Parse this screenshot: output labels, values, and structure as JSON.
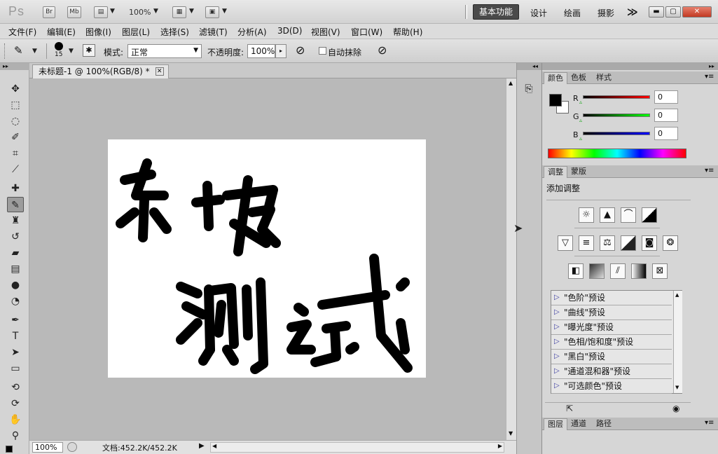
{
  "app": {
    "logo": "Ps",
    "br": "Br",
    "mb": "Mb",
    "zoom": "100%",
    "workspaces": [
      "基本功能",
      "设计",
      "绘画",
      "摄影"
    ],
    "more": "≫"
  },
  "menu": [
    "文件(F)",
    "编辑(E)",
    "图像(I)",
    "图层(L)",
    "选择(S)",
    "滤镜(T)",
    "分析(A)",
    "3D(D)",
    "视图(V)",
    "窗口(W)",
    "帮助(H)"
  ],
  "options": {
    "brush_size": "15",
    "mode_label": "模式:",
    "mode_value": "正常",
    "opacity_label": "不透明度:",
    "opacity_value": "100%",
    "auto_erase": "自动抹除"
  },
  "document": {
    "tab_title": "未标题-1 @ 100%(RGB/8) *",
    "canvas_text_line1": "东坡",
    "canvas_text_line2": "测试",
    "status_zoom": "100%",
    "status_doc": "文档:452.2K/452.2K"
  },
  "color_panel": {
    "tabs": [
      "颜色",
      "色板",
      "样式"
    ],
    "r_label": "R",
    "g_label": "G",
    "b_label": "B",
    "r_value": "0",
    "g_value": "0",
    "b_value": "0",
    "fg_color": "#000000",
    "bg_color": "#ffffff"
  },
  "adjust_panel": {
    "tabs": [
      "调整",
      "蒙版"
    ],
    "title": "添加调整",
    "presets": [
      "\"色阶\"预设",
      "\"曲线\"预设",
      "\"曝光度\"预设",
      "\"色相/饱和度\"预设",
      "\"黑白\"预设",
      "\"通道混和器\"预设",
      "\"可选颜色\"预设"
    ]
  },
  "layers_panel": {
    "tabs": [
      "图层",
      "通道",
      "路径"
    ]
  },
  "colors": {
    "accent_dark": "#4a4a4a",
    "canvas_bg": "#ffffff",
    "workspace_bg": "#b9b9b9"
  }
}
